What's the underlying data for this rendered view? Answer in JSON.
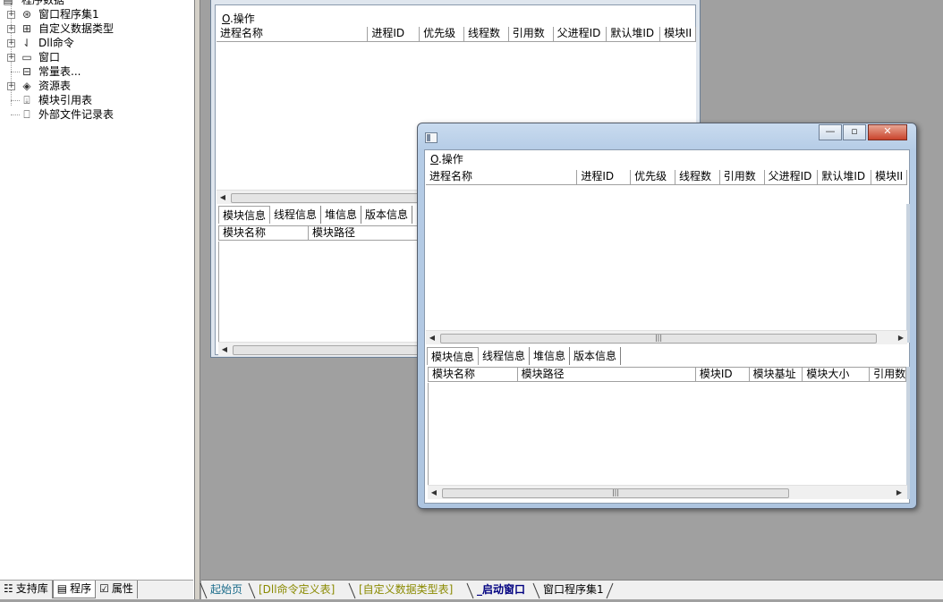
{
  "tree": {
    "root_label": "程序数据",
    "items": [
      {
        "label": "窗口程序集1",
        "icon": "assembly-icon",
        "expandable": true
      },
      {
        "label": "自定义数据类型",
        "icon": "datatype-icon",
        "expandable": true
      },
      {
        "label": "Dll命令",
        "icon": "dll-icon",
        "expandable": true
      },
      {
        "label": "窗口",
        "icon": "window-icon",
        "expandable": true
      },
      {
        "label": "常量表...",
        "icon": "constant-table-icon",
        "expandable": false
      },
      {
        "label": "资源表",
        "icon": "resource-icon",
        "expandable": true
      },
      {
        "label": "模块引用表",
        "icon": "module-ref-icon",
        "expandable": false
      },
      {
        "label": "外部文件记录表",
        "icon": "external-file-icon",
        "expandable": false
      }
    ]
  },
  "left_tabs": [
    {
      "label": "支持库",
      "icon": "library-icon",
      "active": false
    },
    {
      "label": "程序",
      "icon": "program-icon",
      "active": true
    },
    {
      "label": "属性",
      "icon": "property-icon",
      "active": false
    }
  ],
  "window_back": {
    "menu": {
      "hotkey": "O",
      "label": ".操作"
    },
    "process_columns": [
      "进程名称",
      "进程ID",
      "优先级",
      "线程数",
      "引用数",
      "父进程ID",
      "默认堆ID",
      "模块II"
    ],
    "tabs": [
      "模块信息",
      "线程信息",
      "堆信息",
      "版本信息"
    ],
    "module_columns": [
      "模块名称",
      "模块路径"
    ]
  },
  "window_front": {
    "menu": {
      "hotkey": "O",
      "label": ".操作"
    },
    "process_columns": [
      "进程名称",
      "进程ID",
      "优先级",
      "线程数",
      "引用数",
      "父进程ID",
      "默认堆ID",
      "模块II"
    ],
    "tabs": [
      "模块信息",
      "线程信息",
      "堆信息",
      "版本信息"
    ],
    "module_columns": [
      "模块名称",
      "模块路径",
      "模块ID",
      "模块基址",
      "模块大小",
      "引用数"
    ]
  },
  "bottom_tabs": [
    {
      "label": "起始页",
      "color": "#1a6b8a",
      "active": false
    },
    {
      "label": "[Dll命令定义表]",
      "color": "#8a8a00",
      "active": false
    },
    {
      "label": "[自定义数据类型表]",
      "color": "#8a8a00",
      "active": false
    },
    {
      "label": "_启动窗口",
      "color": "#000080",
      "active": true
    },
    {
      "label": "窗口程序集1",
      "color": "#000000",
      "active": false
    }
  ]
}
